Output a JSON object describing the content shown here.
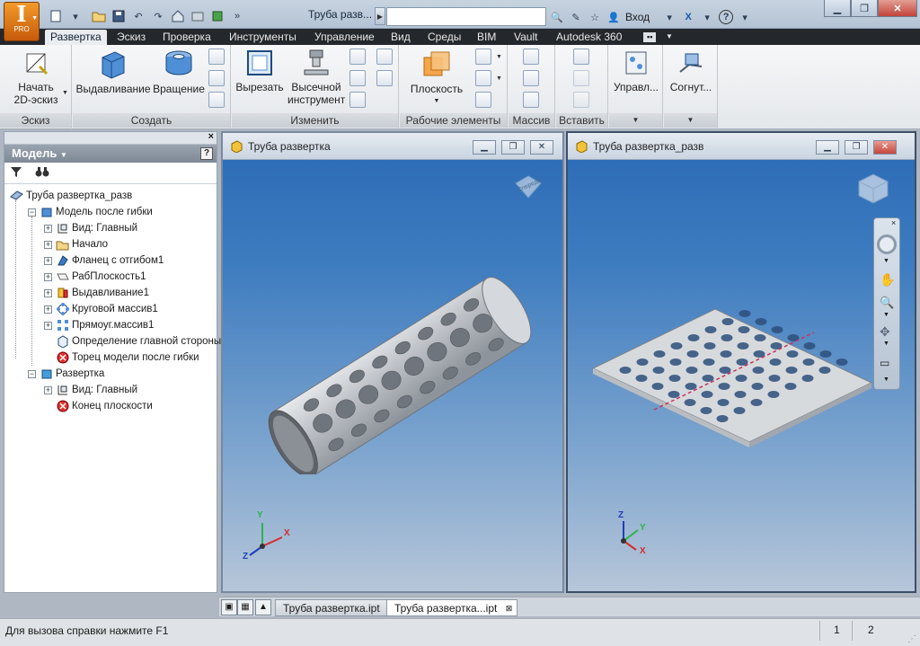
{
  "app": {
    "logo_letter": "I",
    "logo_edition": "PRO"
  },
  "titlebar": {
    "document_title": "Труба разв...",
    "search_placeholder": "",
    "login_label": "Вход"
  },
  "tabs": [
    "Развертка",
    "Эскиз",
    "Проверка",
    "Инструменты",
    "Управление",
    "Вид",
    "Среды",
    "BIM",
    "Vault",
    "Autodesk 360"
  ],
  "ribbon": {
    "sketch": {
      "start_label_line1": "Начать",
      "start_label_line2": "2D-эскиз",
      "panel": "Эскиз"
    },
    "create": {
      "extrude": "Выдавливание",
      "revolve": "Вращение",
      "panel": "Создать"
    },
    "modify": {
      "cut": "Вырезать",
      "punch_line1": "Высечной",
      "punch_line2": "инструмент",
      "panel": "Изменить"
    },
    "work": {
      "plane": "Плоскость",
      "panel": "Рабочие элементы"
    },
    "pattern": {
      "panel": "Массив"
    },
    "insert": {
      "panel": "Вставить"
    },
    "manage": {
      "label": "Управл..."
    },
    "fold": {
      "label": "Согнут..."
    }
  },
  "browser": {
    "title": "Модель",
    "help": "?",
    "tree": [
      {
        "label": "Труба развертка_разв",
        "level": 0,
        "expander": ""
      },
      {
        "label": "Модель после гибки",
        "level": 1,
        "expander": "−"
      },
      {
        "label": "Вид: Главный",
        "level": 2,
        "expander": "+"
      },
      {
        "label": "Начало",
        "level": 2,
        "expander": "+"
      },
      {
        "label": "Фланец с отгибом1",
        "level": 2,
        "expander": "+"
      },
      {
        "label": "РабПлоскость1",
        "level": 2,
        "expander": "+"
      },
      {
        "label": "Выдавливание1",
        "level": 2,
        "expander": "+"
      },
      {
        "label": "Круговой массив1",
        "level": 2,
        "expander": "+"
      },
      {
        "label": "Прямоуг.массив1",
        "level": 2,
        "expander": "+"
      },
      {
        "label": "Определение главной стороны",
        "level": 2,
        "expander": ""
      },
      {
        "label": "Торец модели после гибки",
        "level": 2,
        "expander": ""
      },
      {
        "label": "Развертка",
        "level": 1,
        "expander": "−"
      },
      {
        "label": "Вид: Главный",
        "level": 2,
        "expander": "+"
      },
      {
        "label": "Конец плоскости",
        "level": 2,
        "expander": ""
      }
    ]
  },
  "viewports": [
    {
      "title": "Труба развертка",
      "viewcube": "Спереди"
    },
    {
      "title": "Труба развертка_разв"
    }
  ],
  "axes": {
    "x": "X",
    "y": "Y",
    "z": "Z"
  },
  "doc_tabs": [
    "Труба развертка.ipt",
    "Труба развертка...ipt"
  ],
  "status": {
    "text": "Для вызова справки нажмите F1",
    "count1": "1",
    "count2": "2"
  },
  "colors": {
    "accent": "#1f5ea8",
    "viewport_top": "#2a6ab5",
    "viewport_bottom": "#b7c6d9",
    "logo": "#e8821c"
  }
}
